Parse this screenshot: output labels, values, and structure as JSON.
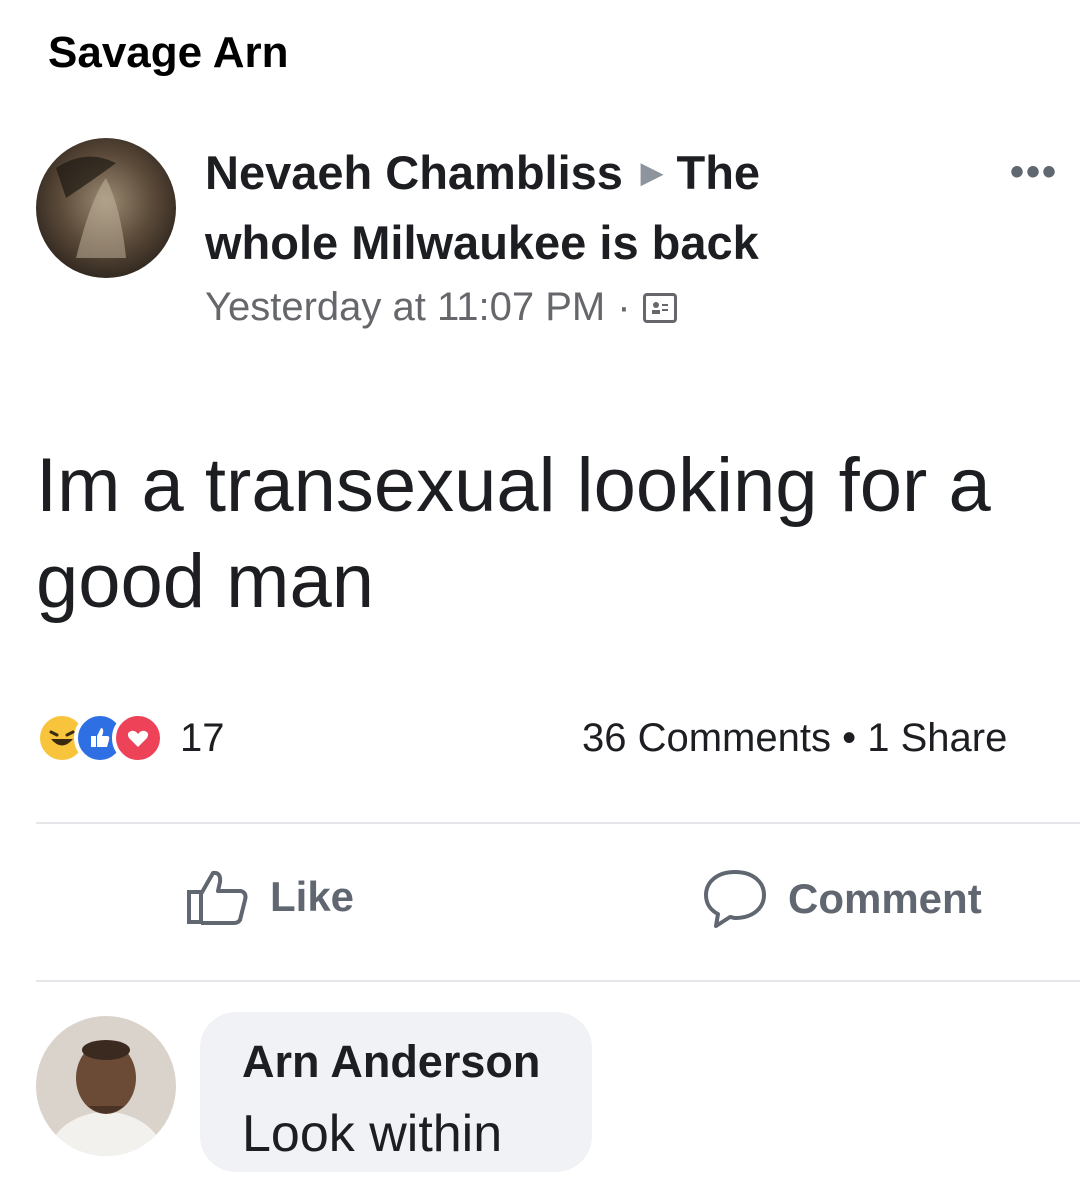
{
  "caption": "Savage Arn",
  "post": {
    "author": "Nevaeh Chambliss",
    "target_line1": "The",
    "target_line2": "whole Milwaukee is back",
    "timestamp": "Yesterday at 11:07 PM",
    "text": "Im a transexual looking for a good man",
    "reaction_count": "17",
    "comments_shares": "36 Comments • 1 Share"
  },
  "actions": {
    "like": "Like",
    "comment": "Comment"
  },
  "comment": {
    "author": "Arn Anderson",
    "text": "Look within"
  }
}
